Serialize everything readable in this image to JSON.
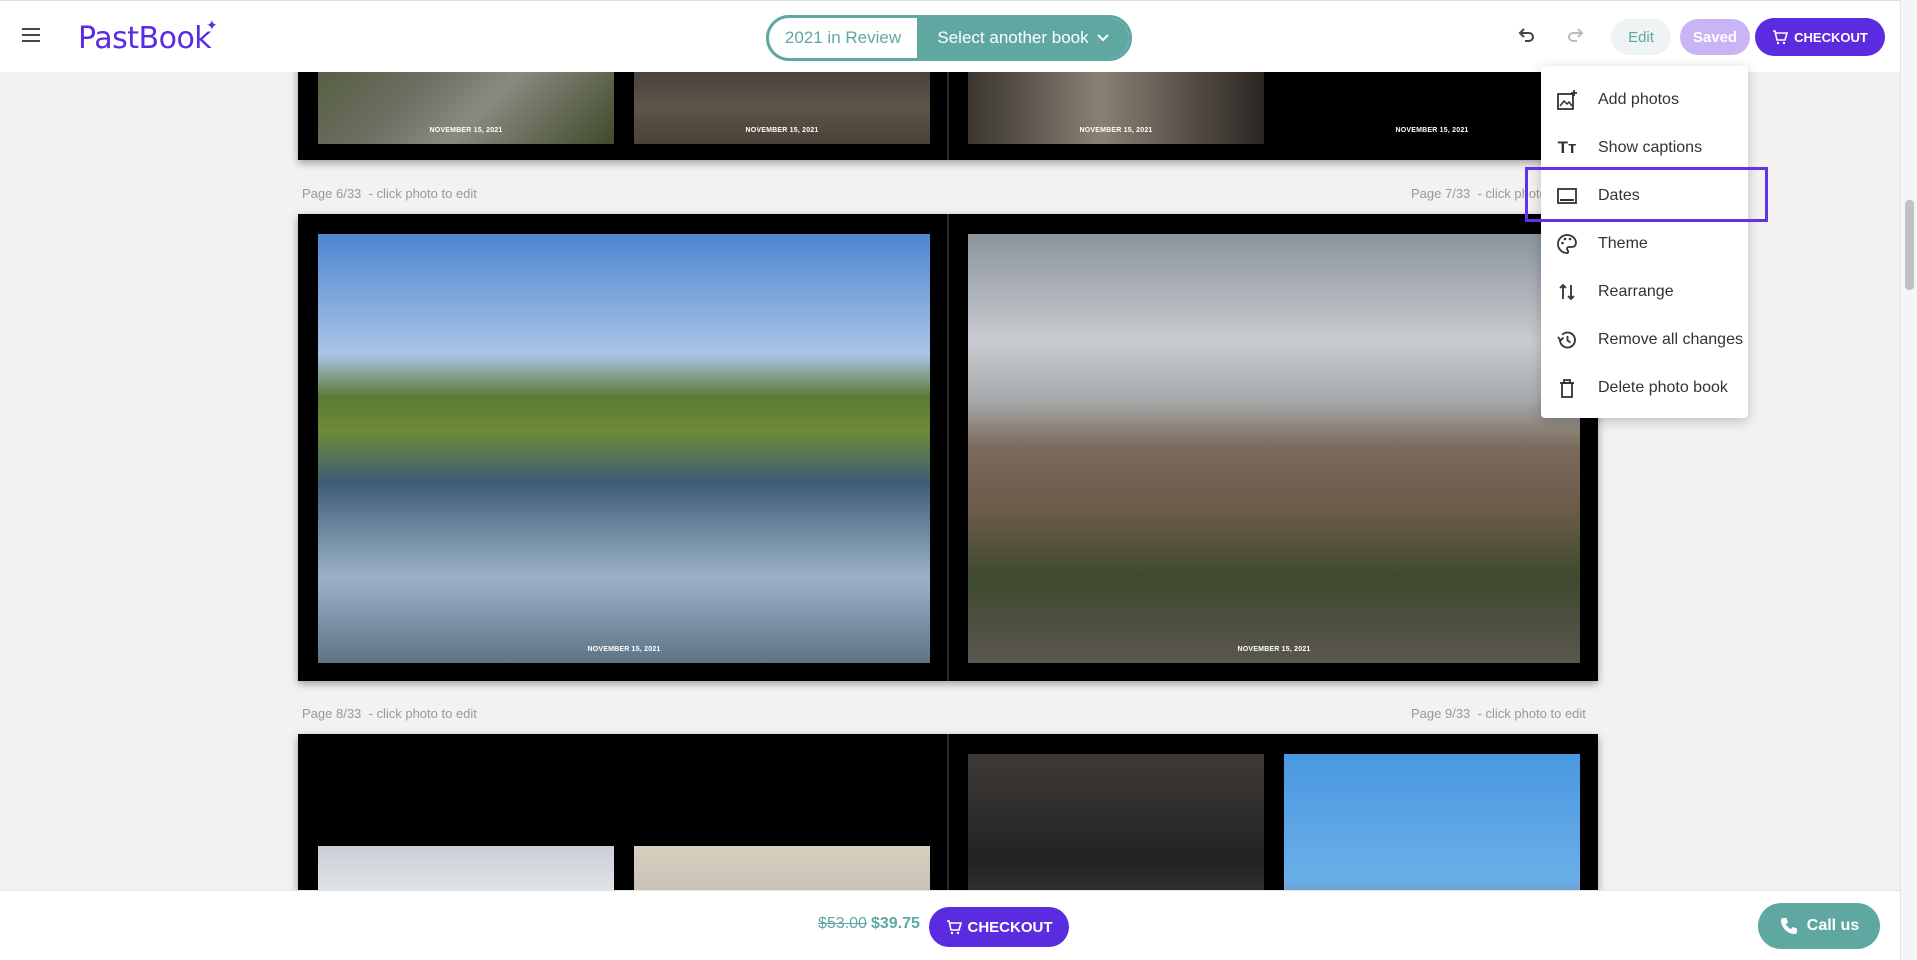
{
  "header": {
    "logo": "PastBook",
    "book_current": "2021 in Review",
    "book_select": "Select another book",
    "edit_label": "Edit",
    "saved_label": "Saved",
    "checkout_label": "CHECKOUT"
  },
  "edit_menu": {
    "items": [
      {
        "label": "Add photos",
        "icon": "add-photo-icon"
      },
      {
        "label": "Show captions",
        "icon": "text-size-icon"
      },
      {
        "label": "Dates",
        "icon": "dates-icon"
      },
      {
        "label": "Theme",
        "icon": "palette-icon"
      },
      {
        "label": "Rearrange",
        "icon": "rearrange-icon"
      },
      {
        "label": "Remove all changes",
        "icon": "history-icon"
      },
      {
        "label": "Delete photo book",
        "icon": "trash-icon"
      }
    ]
  },
  "pages": {
    "date_text": "NOVEMBER 15, 2021",
    "label_6": "Page 6/33",
    "label_7": "Page 7/33",
    "label_8": "Page 8/33",
    "label_9": "Page 9/33",
    "hint": "- click photo to edit"
  },
  "footer": {
    "price_old": "$53.00",
    "price_new": "$39.75",
    "checkout_label": "CHECKOUT",
    "call_label": "Call us"
  },
  "colors": {
    "brand_purple": "#5b2be0",
    "teal": "#5fa8a2",
    "highlight": "#6232e8"
  }
}
